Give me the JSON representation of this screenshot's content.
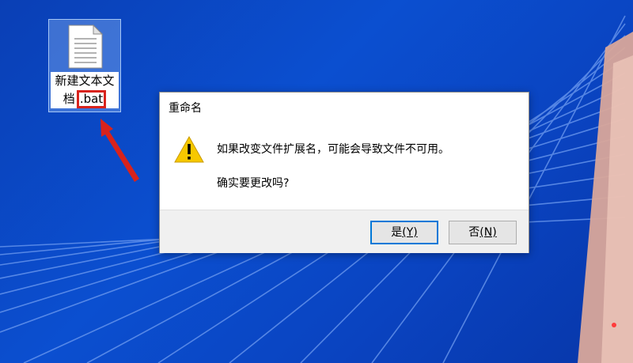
{
  "desktop": {
    "file_icon": {
      "label_line1": "新建文本文",
      "label_prefix": "档",
      "label_ext": ".bat"
    },
    "annotation_color": "#d8231c"
  },
  "dialog": {
    "title": "重命名",
    "icon": "warning-icon",
    "message": "如果改变文件扩展名，可能会导致文件不可用。",
    "question": "确实要更改吗?",
    "yes_button": {
      "label": "是",
      "accel": "(Y)"
    },
    "no_button": {
      "label": "否",
      "accel": "(N)"
    }
  },
  "colors": {
    "desktop_blue": "#0b4fd0",
    "focus_border": "#0078d7",
    "warning_yellow": "#f7c800"
  }
}
